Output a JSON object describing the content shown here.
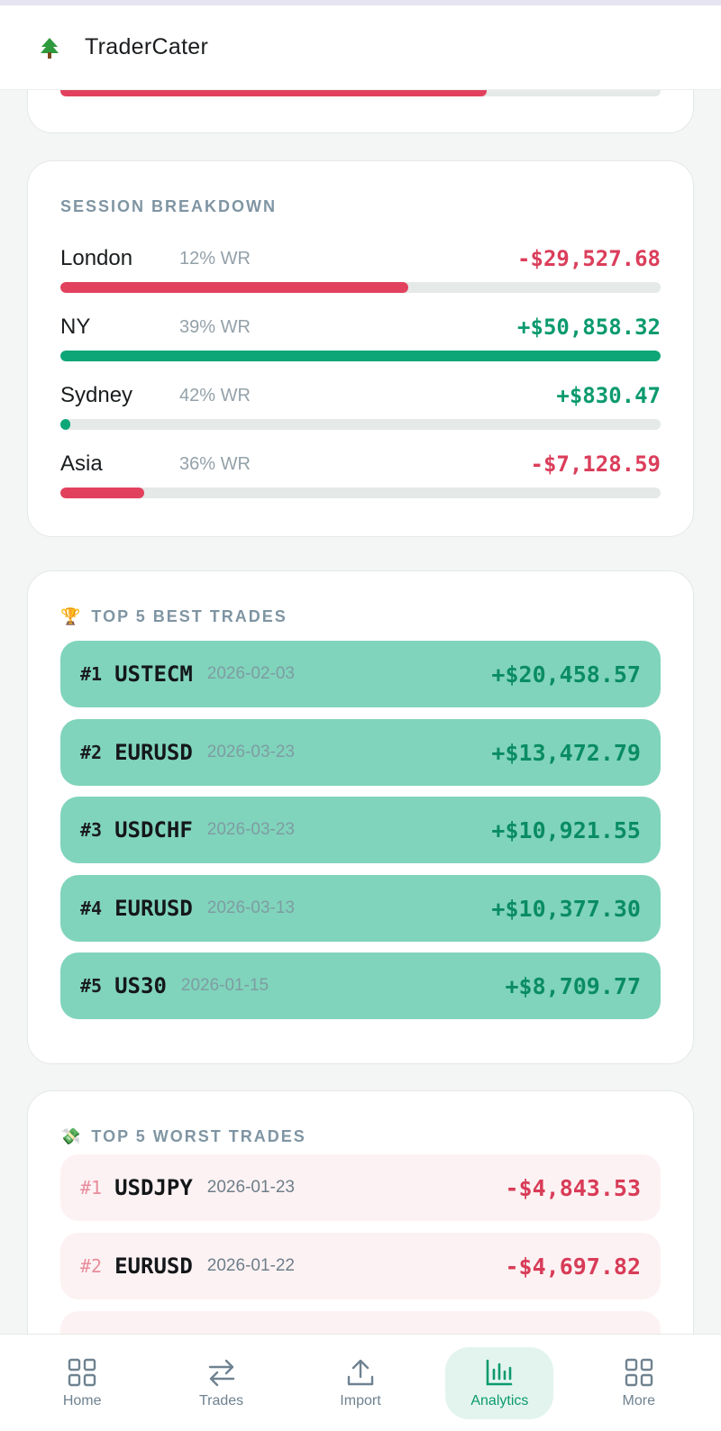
{
  "header": {
    "app_title": "TraderCater",
    "logo_icon": "tree-icon"
  },
  "top_card": {
    "bar_fraction": 0.71,
    "bar_color": "#e2415e"
  },
  "session_breakdown": {
    "title": "SESSION BREAKDOWN",
    "rows": [
      {
        "name": "London",
        "win_rate": "12% WR",
        "amount": "-$29,527.68",
        "bar_fraction": 0.58,
        "positive": false
      },
      {
        "name": "NY",
        "win_rate": "39% WR",
        "amount": "+$50,858.32",
        "bar_fraction": 1.0,
        "positive": true
      },
      {
        "name": "Sydney",
        "win_rate": "42% WR",
        "amount": "+$830.47",
        "bar_fraction": 0.016,
        "positive": true
      },
      {
        "name": "Asia",
        "win_rate": "36% WR",
        "amount": "-$7,128.59",
        "bar_fraction": 0.14,
        "positive": false
      }
    ]
  },
  "best_trades": {
    "emoji": "🏆",
    "title": "TOP 5 BEST TRADES",
    "rows": [
      {
        "rank": "#1",
        "symbol": "USTECM",
        "date": "2026-02-03",
        "amount": "+$20,458.57"
      },
      {
        "rank": "#2",
        "symbol": "EURUSD",
        "date": "2026-03-23",
        "amount": "+$13,472.79"
      },
      {
        "rank": "#3",
        "symbol": "USDCHF",
        "date": "2026-03-23",
        "amount": "+$10,921.55"
      },
      {
        "rank": "#4",
        "symbol": "EURUSD",
        "date": "2026-03-13",
        "amount": "+$10,377.30"
      },
      {
        "rank": "#5",
        "symbol": "US30",
        "date": "2026-01-15",
        "amount": "+$8,709.77"
      }
    ]
  },
  "worst_trades": {
    "emoji": "💸",
    "title": "TOP 5 WORST TRADES",
    "rows": [
      {
        "rank": "#1",
        "symbol": "USDJPY",
        "date": "2026-01-23",
        "amount": "-$4,843.53"
      },
      {
        "rank": "#2",
        "symbol": "EURUSD",
        "date": "2026-01-22",
        "amount": "-$4,697.82"
      }
    ]
  },
  "bottom_nav": {
    "items": [
      {
        "label": "Home",
        "icon": "grid-icon",
        "active": false
      },
      {
        "label": "Trades",
        "icon": "swap-arrows-icon",
        "active": false
      },
      {
        "label": "Import",
        "icon": "upload-icon",
        "active": false
      },
      {
        "label": "Analytics",
        "icon": "bar-chart-icon",
        "active": true
      },
      {
        "label": "More",
        "icon": "grid-icon",
        "active": false
      }
    ]
  },
  "colors": {
    "accent_green": "#0b9a6e",
    "loss_red": "#db3e5b",
    "best_row_bg": "#80d4bb",
    "worst_row_bg": "#fdf2f3"
  }
}
